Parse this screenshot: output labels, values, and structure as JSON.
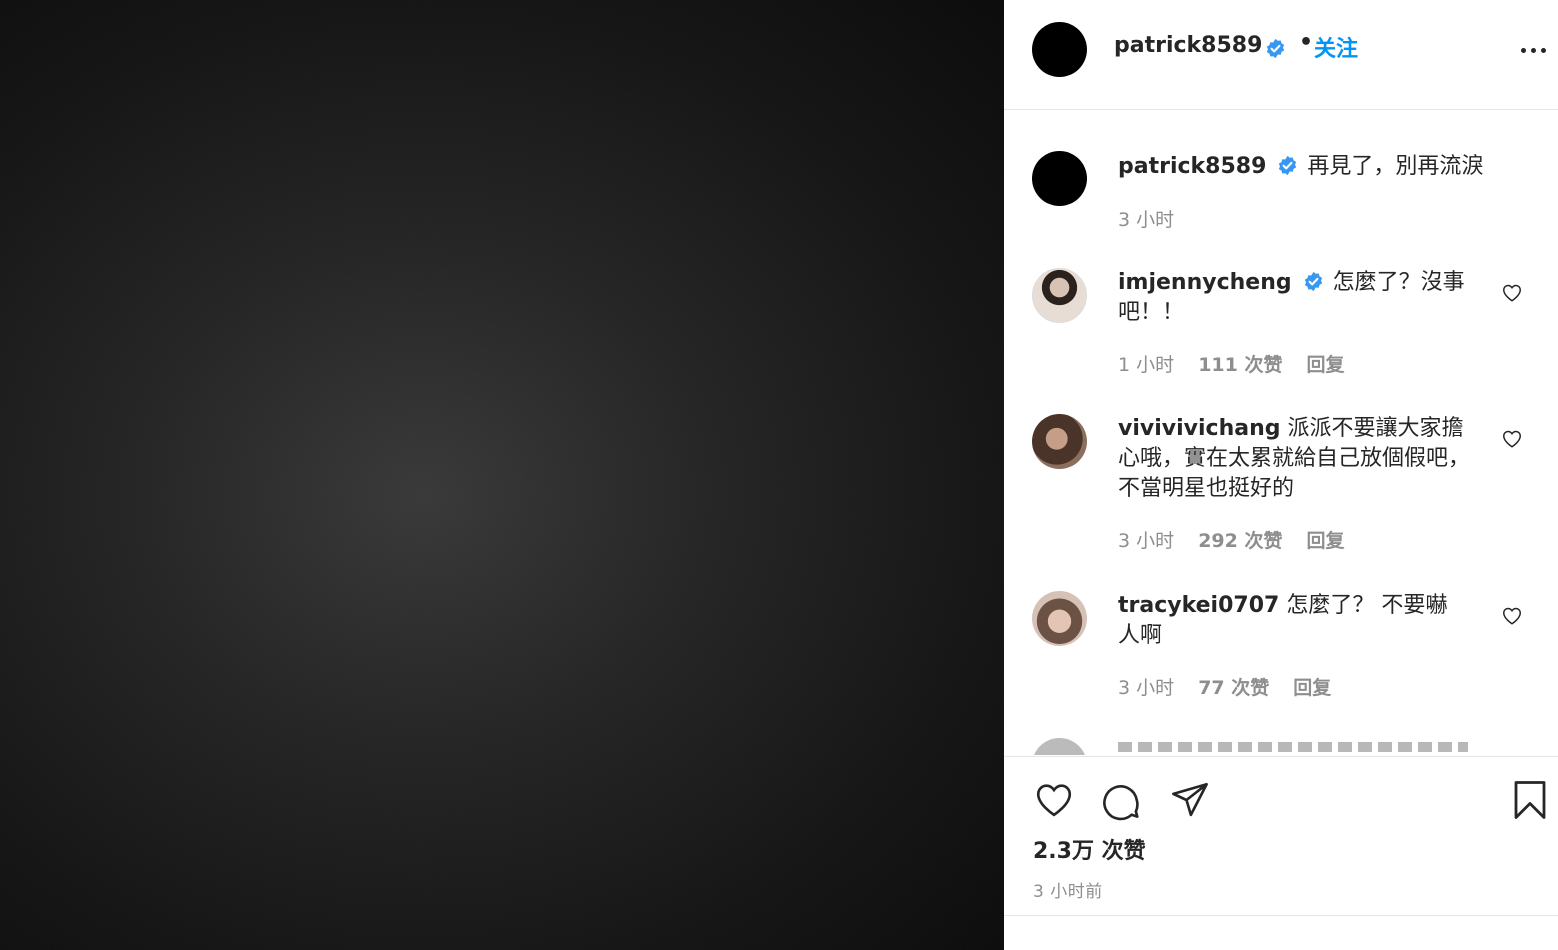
{
  "post": {
    "author": "patrick8589",
    "dot": "•",
    "follow_label": "关注"
  },
  "caption": {
    "username": "patrick8589",
    "text": "再見了，別再流淚",
    "time": "3 小时"
  },
  "comments": [
    {
      "username": "imjennycheng",
      "verified": true,
      "text": "怎麼了？沒事吧！！",
      "time": "1 小时",
      "likes": "111 次赞",
      "reply": "回复"
    },
    {
      "username": "vivivivichang",
      "verified": false,
      "text": "派派不要讓大家擔心哦，實在太累就給自己放個假吧，不當明星也挺好的",
      "time": "3 小时",
      "likes": "292 次赞",
      "reply": "回复"
    },
    {
      "username": "tracykei0707",
      "verified": false,
      "text": "怎麼了？ 不要嚇人啊",
      "time": "3 小时",
      "likes": "77 次赞",
      "reply": "回复"
    },
    {
      "username": "",
      "text": "",
      "partial": true
    }
  ],
  "stats": {
    "likes": "2.3万 次赞",
    "posted": "3 小时前"
  },
  "colors": {
    "link_blue": "#0095f6",
    "verified_blue": "#3897f0",
    "text": "#262626",
    "muted": "#8e8e8e"
  },
  "icons": [
    "more-icon",
    "verified-icon",
    "heart-icon",
    "comment-icon",
    "share-icon",
    "bookmark-icon"
  ]
}
